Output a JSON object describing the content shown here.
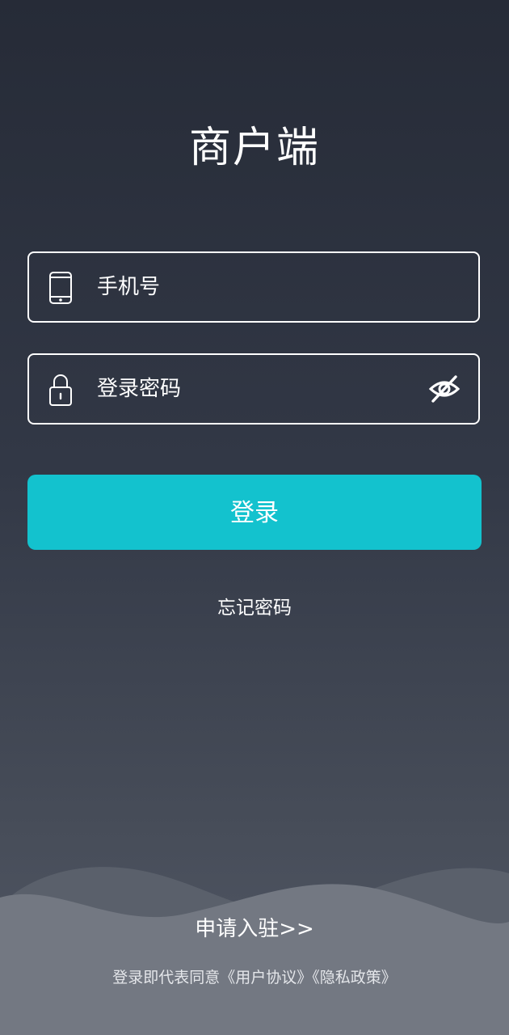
{
  "app": {
    "title": "商户端"
  },
  "form": {
    "phone": {
      "icon": "phone-icon",
      "placeholder": "手机号",
      "value": ""
    },
    "password": {
      "icon": "lock-icon",
      "placeholder": "登录密码",
      "value": "",
      "toggle_icon": "eye-off-icon"
    },
    "login_label": "登录",
    "forgot_label": "忘记密码"
  },
  "footer": {
    "apply_label": "申请入驻>>",
    "agreement_prefix": "登录即代表同意",
    "user_agreement": "《用户协议》",
    "privacy_policy": "《隐私政策》"
  },
  "colors": {
    "accent": "#13c2ce",
    "bg_top": "#262b37",
    "bg_bottom": "#525866"
  }
}
